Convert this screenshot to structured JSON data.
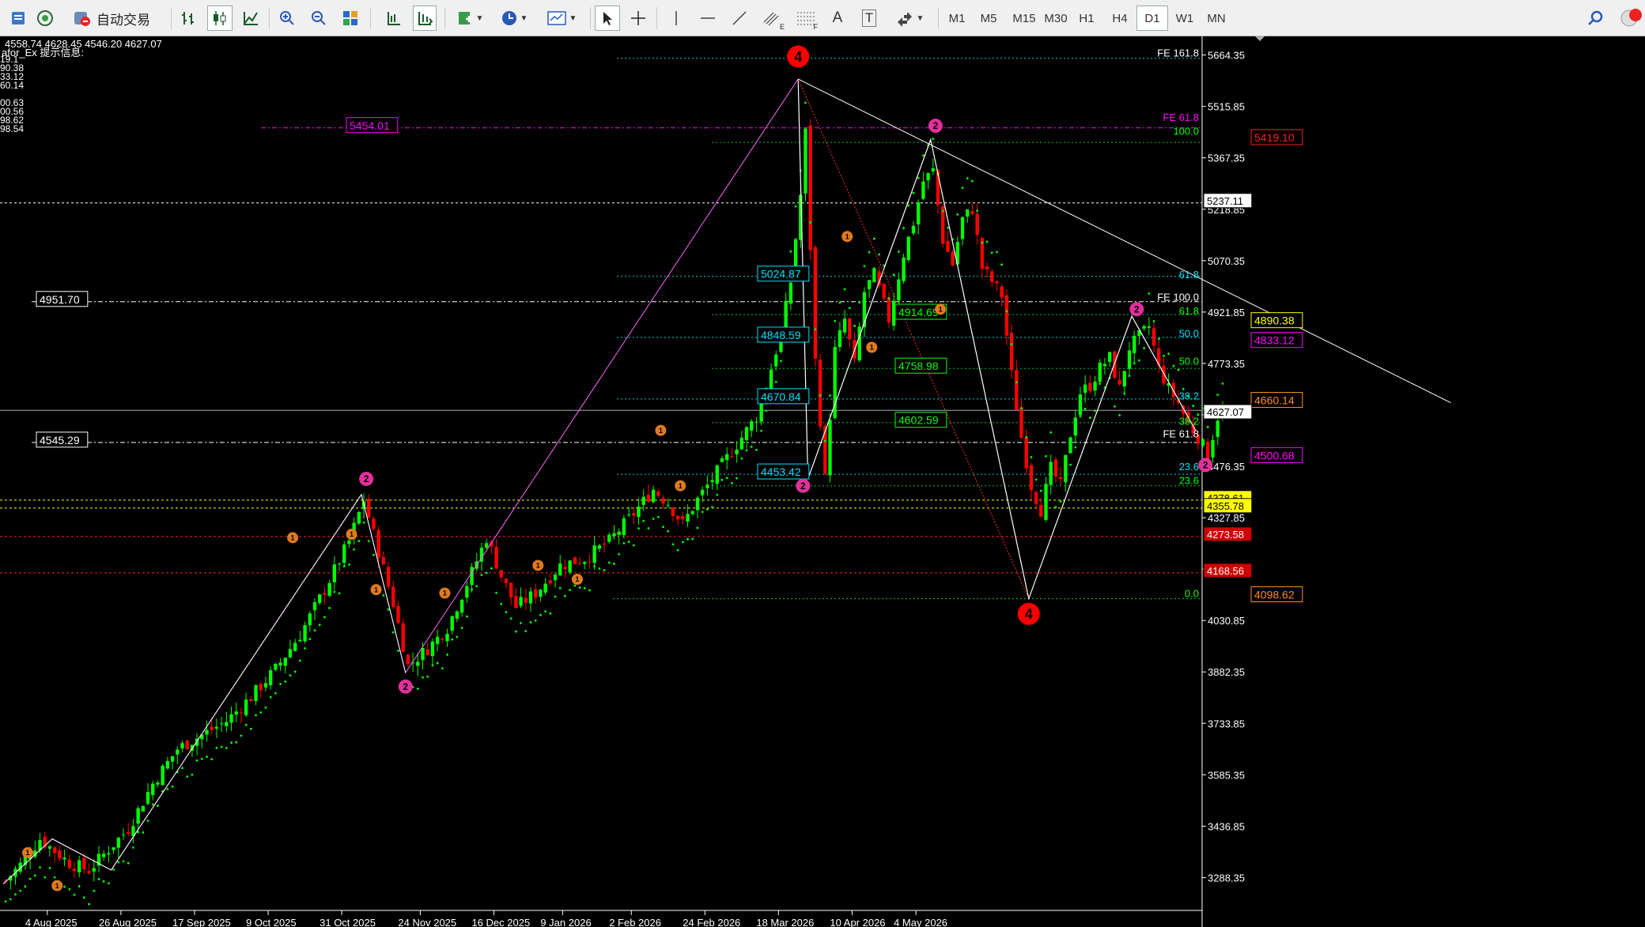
{
  "toolbar": {
    "autotrade_label": "自动交易",
    "timeframes": [
      "M1",
      "M5",
      "M15",
      "M30",
      "H1",
      "H4",
      "D1",
      "W1",
      "MN"
    ],
    "active_timeframe": "D1",
    "text_tool": "A",
    "label_tool": "T",
    "fib_fan_caption": "F",
    "fib_channel_caption": "E"
  },
  "header": {
    "ohlc": "4558.74 4628.45 4546.20 4627.07",
    "indicator_info": "afor_Ex 提示信息:",
    "clipped_values": [
      "19.1",
      "90.38",
      "33.12",
      "60.14",
      "00.63",
      "00.56",
      "98.62",
      "98.54"
    ]
  },
  "price_axis": {
    "ticks": [
      "5664.35",
      "5515.85",
      "5367.35",
      "5218.85",
      "5070.35",
      "4921.85",
      "4773.35",
      "4624.85",
      "4476.35",
      "4327.85",
      "4179.35",
      "4030.85",
      "3882.35",
      "3733.85",
      "3585.35",
      "3436.85",
      "3288.35"
    ],
    "current_price": "4627.07",
    "tags": [
      {
        "text": "5237.11",
        "color": "#ffffff"
      },
      {
        "text": "4378.61",
        "color": "#ffff00"
      },
      {
        "text": "4355.78",
        "color": "#ffff00"
      },
      {
        "text": "4273.58",
        "color": "#ff2020"
      },
      {
        "text": "4168.56",
        "color": "#ff2020"
      }
    ]
  },
  "time_axis": [
    "4 Aug 2025",
    "26 Aug 2025",
    "17 Sep 2025",
    "9 Oct 2025",
    "31 Oct 2025",
    "24 Nov 2025",
    "16 Dec 2025",
    "9 Jan 2026",
    "2 Feb 2026",
    "24 Feb 2026",
    "18 Mar 2026",
    "10 Apr 2026",
    "4 May 2026"
  ],
  "level_labels": [
    {
      "text": "5454.01",
      "color": "#ff00ff"
    },
    {
      "text": "4951.70",
      "color": "#ffffff"
    },
    {
      "text": "4545.29",
      "color": "#ffffff"
    },
    {
      "text": "5024.87",
      "color": "#00e0ff"
    },
    {
      "text": "4848.59",
      "color": "#00e0ff"
    },
    {
      "text": "4670.84",
      "color": "#00e0ff"
    },
    {
      "text": "4453.42",
      "color": "#00e0ff"
    },
    {
      "text": "4914.69",
      "color": "#00ff00"
    },
    {
      "text": "4758.98",
      "color": "#00ff00"
    },
    {
      "text": "4602.59",
      "color": "#00ff00"
    },
    {
      "text": "5419.10",
      "color": "#ff2020"
    },
    {
      "text": "4890.38",
      "color": "#ffff00"
    },
    {
      "text": "4833.12",
      "color": "#ff00ff"
    },
    {
      "text": "4660.14",
      "color": "#ff8c1a"
    },
    {
      "text": "4500.68",
      "color": "#ff00ff"
    },
    {
      "text": "4098.62",
      "color": "#ff8c1a"
    }
  ],
  "fib_labels": [
    {
      "text": "FE 161.8",
      "color": "#ffffff"
    },
    {
      "text": "FE 61.8",
      "color": "#ff00ff"
    },
    {
      "text": "100.0",
      "color": "#00ff00"
    },
    {
      "text": "61.8",
      "color": "#00e0ff"
    },
    {
      "text": "FE 100.0",
      "color": "#ffffff"
    },
    {
      "text": "61.8",
      "color": "#00ff00"
    },
    {
      "text": "50.0",
      "color": "#00e0ff"
    },
    {
      "text": "50.0",
      "color": "#00ff00"
    },
    {
      "text": "38.2",
      "color": "#00e0ff"
    },
    {
      "text": "38.2",
      "color": "#00ff00"
    },
    {
      "text": "FE 61.8",
      "color": "#ffffff"
    },
    {
      "text": "23.6",
      "color": "#00e0ff"
    },
    {
      "text": "23.6",
      "color": "#00ff00"
    },
    {
      "text": "0.0",
      "color": "#00ff00"
    }
  ],
  "wave_labels": [
    {
      "text": "4",
      "color": "#ff0000"
    },
    {
      "text": "4",
      "color": "#ff0000"
    },
    {
      "text": "2",
      "color": "#e0309a"
    },
    {
      "text": "2",
      "color": "#e0309a"
    },
    {
      "text": "2",
      "color": "#e0309a"
    },
    {
      "text": "2",
      "color": "#e0309a"
    },
    {
      "text": "2",
      "color": "#e0309a"
    },
    {
      "text": "2",
      "color": "#e0309a"
    },
    {
      "text": "1",
      "color": "#e07a20"
    },
    {
      "text": "1",
      "color": "#e07a20"
    },
    {
      "text": "1",
      "color": "#e07a20"
    },
    {
      "text": "1",
      "color": "#e07a20"
    },
    {
      "text": "1",
      "color": "#e07a20"
    },
    {
      "text": "1",
      "color": "#e07a20"
    },
    {
      "text": "1",
      "color": "#e07a20"
    },
    {
      "text": "1",
      "color": "#e07a20"
    },
    {
      "text": "1",
      "color": "#e07a20"
    },
    {
      "text": "1",
      "color": "#e07a20"
    },
    {
      "text": "1",
      "color": "#e07a20"
    },
    {
      "text": "1",
      "color": "#e07a20"
    },
    {
      "text": "1",
      "color": "#e07a20"
    }
  ],
  "colors": {
    "bull": "#00ff00",
    "bear": "#ff0000",
    "background": "#000000",
    "sar": "#00ff00"
  },
  "chart_data": {
    "type": "candlestick",
    "title": "",
    "ylim": [
      3230,
      5700
    ],
    "timeframe": "D1",
    "last_close": 4627.07,
    "horizontal_levels": [
      5237.11,
      4951.7,
      4545.29,
      5454.01,
      4378.61,
      4355.78,
      4273.58,
      4168.56
    ],
    "close_path": [
      [
        0,
        3280
      ],
      [
        3,
        3325
      ],
      [
        7,
        3400
      ],
      [
        10,
        3365
      ],
      [
        13,
        3330
      ],
      [
        17,
        3310
      ],
      [
        20,
        3355
      ],
      [
        25,
        3430
      ],
      [
        30,
        3560
      ],
      [
        35,
        3660
      ],
      [
        40,
        3700
      ],
      [
        45,
        3740
      ],
      [
        50,
        3810
      ],
      [
        55,
        3890
      ],
      [
        60,
        3990
      ],
      [
        65,
        4120
      ],
      [
        70,
        4260
      ],
      [
        73,
        4380
      ],
      [
        76,
        4230
      ],
      [
        79,
        4080
      ],
      [
        82,
        3900
      ],
      [
        86,
        3950
      ],
      [
        90,
        4010
      ],
      [
        95,
        4170
      ],
      [
        98,
        4270
      ],
      [
        101,
        4160
      ],
      [
        104,
        4070
      ],
      [
        108,
        4110
      ],
      [
        113,
        4190
      ],
      [
        118,
        4210
      ],
      [
        123,
        4260
      ],
      [
        128,
        4340
      ],
      [
        132,
        4410
      ],
      [
        135,
        4370
      ],
      [
        138,
        4310
      ],
      [
        141,
        4380
      ],
      [
        145,
        4460
      ],
      [
        149,
        4540
      ],
      [
        153,
        4620
      ],
      [
        155,
        4710
      ],
      [
        158,
        4860
      ],
      [
        160,
        5010
      ],
      [
        162,
        5260
      ],
      [
        163,
        5440
      ],
      [
        165,
        4780
      ],
      [
        167,
        4440
      ],
      [
        169,
        4810
      ],
      [
        171,
        4900
      ],
      [
        173,
        4770
      ],
      [
        175,
        4980
      ],
      [
        177,
        5030
      ],
      [
        180,
        4900
      ],
      [
        183,
        5090
      ],
      [
        185,
        5180
      ],
      [
        187,
        5300
      ],
      [
        189,
        5330
      ],
      [
        191,
        5130
      ],
      [
        193,
        5060
      ],
      [
        195,
        5190
      ],
      [
        197,
        5220
      ],
      [
        199,
        5050
      ],
      [
        201,
        5010
      ],
      [
        203,
        4970
      ],
      [
        205,
        4740
      ],
      [
        207,
        4560
      ],
      [
        209,
        4420
      ],
      [
        211,
        4350
      ],
      [
        213,
        4470
      ],
      [
        215,
        4420
      ],
      [
        217,
        4570
      ],
      [
        219,
        4690
      ],
      [
        221,
        4710
      ],
      [
        223,
        4760
      ],
      [
        225,
        4790
      ],
      [
        227,
        4700
      ],
      [
        229,
        4820
      ],
      [
        231,
        4850
      ],
      [
        233,
        4880
      ],
      [
        235,
        4760
      ],
      [
        237,
        4700
      ],
      [
        239,
        4660
      ],
      [
        241,
        4600
      ],
      [
        243,
        4560
      ],
      [
        245,
        4510
      ],
      [
        247,
        4620
      ],
      [
        248,
        4627.07
      ]
    ],
    "wave_labels_note": "Elliott wave counts 1,2,4 and FE/Fibonacci projections as drawn",
    "fib_levels_retracement": [
      0.0,
      23.6,
      38.2,
      50.0,
      61.8,
      100.0
    ],
    "fib_levels_expansion": [
      61.8,
      100.0,
      161.8
    ]
  }
}
